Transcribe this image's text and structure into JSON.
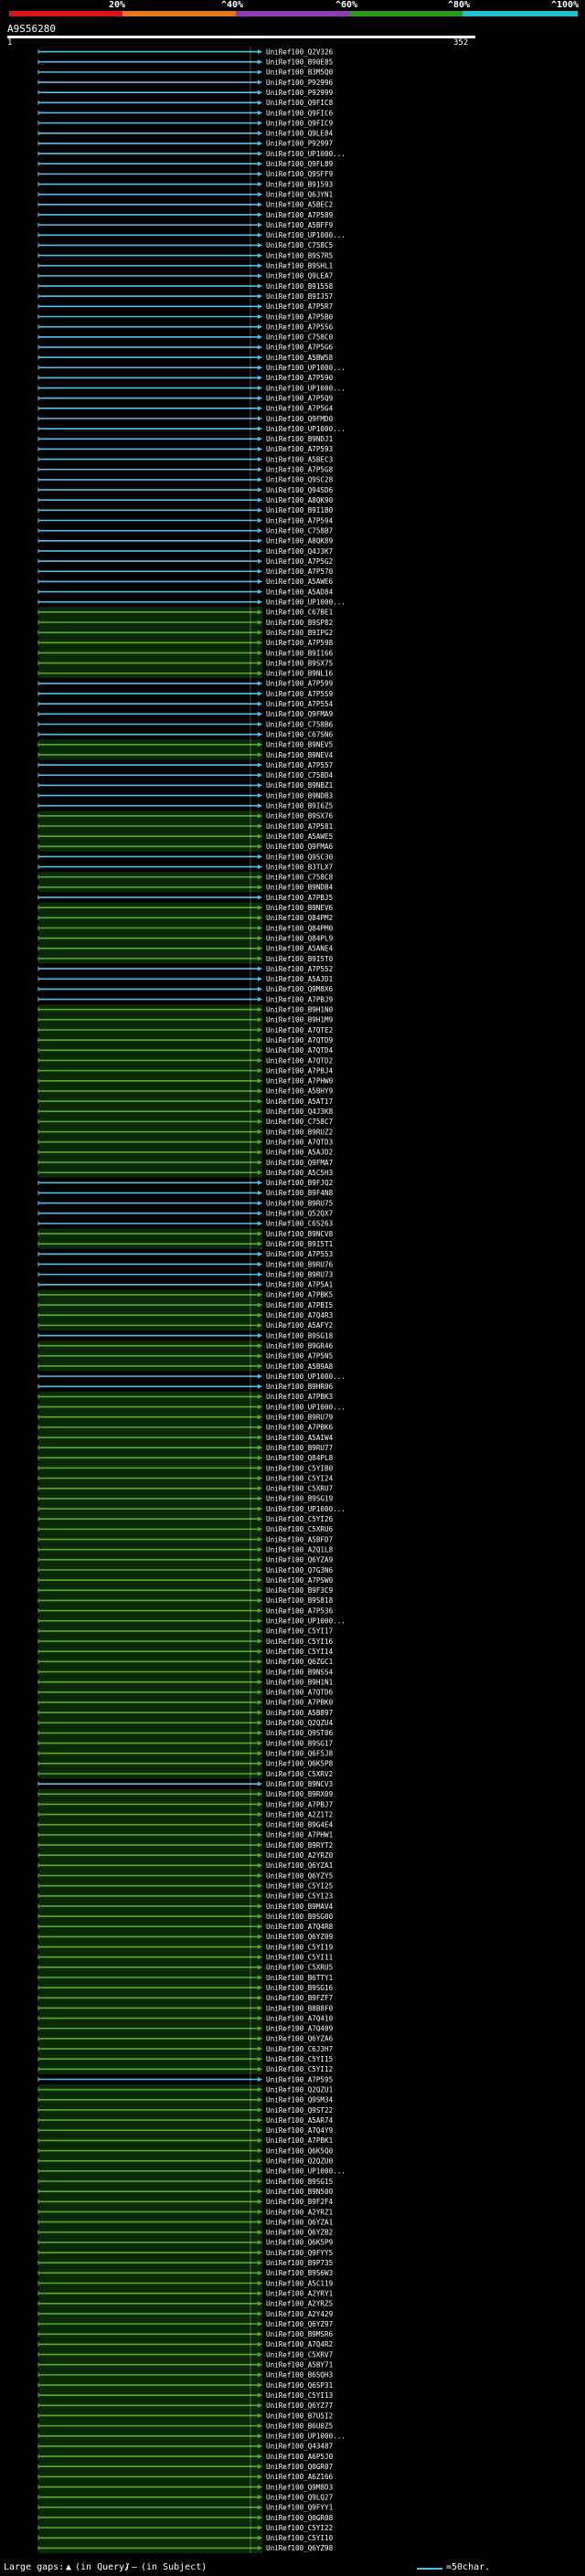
{
  "colors": {
    "cyan": "#4fc1e9",
    "green": "#5ba82a",
    "red": "#d8141c",
    "orange": "#e27a1c",
    "purple": "#8f3ab7",
    "darkgreen": "#2d9a1b",
    "scyan": "#21bfd3"
  },
  "scale": {
    "labels": [
      "20%",
      "^40%",
      "^60%",
      "^80%",
      "^100%"
    ]
  },
  "query": {
    "name": "A9S56280",
    "start": "1",
    "end": "352"
  },
  "hits": [
    {
      "name": "UniRef100_Q2V326",
      "color": "cyan"
    },
    {
      "name": "UniRef100_B90E85",
      "color": "cyan"
    },
    {
      "name": "UniRef100_B3M5Q0",
      "color": "cyan"
    },
    {
      "name": "UniRef100_P92996",
      "color": "cyan"
    },
    {
      "name": "UniRef100_P92999",
      "color": "cyan"
    },
    {
      "name": "UniRef100_Q9FIC8",
      "color": "cyan"
    },
    {
      "name": "UniRef100_Q9FIC6",
      "color": "cyan"
    },
    {
      "name": "UniRef100_Q9FIC9",
      "color": "cyan"
    },
    {
      "name": "UniRef100_Q9LE84",
      "color": "cyan"
    },
    {
      "name": "UniRef100_P92997",
      "color": "cyan"
    },
    {
      "name": "UniRef100_UP1000...",
      "color": "cyan"
    },
    {
      "name": "UniRef100_Q9FL89",
      "color": "cyan"
    },
    {
      "name": "UniRef100_Q9SFF9",
      "color": "cyan"
    },
    {
      "name": "UniRef100_B91593",
      "color": "cyan"
    },
    {
      "name": "UniRef100_Q6JYN1",
      "color": "cyan"
    },
    {
      "name": "UniRef100_A5BEC2",
      "color": "cyan"
    },
    {
      "name": "UniRef100_A7P589",
      "color": "cyan"
    },
    {
      "name": "UniRef100_A5BFF9",
      "color": "cyan"
    },
    {
      "name": "UniRef100_UP1000...",
      "color": "cyan"
    },
    {
      "name": "UniRef100_C758C5",
      "color": "cyan"
    },
    {
      "name": "UniRef100_B9S7R5",
      "color": "cyan"
    },
    {
      "name": "UniRef100_B9SHL1",
      "color": "cyan"
    },
    {
      "name": "UniRef100_Q9LEA7",
      "color": "cyan"
    },
    {
      "name": "UniRef100_B91558",
      "color": "cyan"
    },
    {
      "name": "UniRef100_B9IJ57",
      "color": "cyan"
    },
    {
      "name": "UniRef100_A7P5R7",
      "color": "cyan"
    },
    {
      "name": "UniRef100_A7P5B0",
      "color": "cyan"
    },
    {
      "name": "UniRef100_A7P5S6",
      "color": "cyan"
    },
    {
      "name": "UniRef100_C758C0",
      "color": "cyan"
    },
    {
      "name": "UniRef100_A7P5G6",
      "color": "cyan"
    },
    {
      "name": "UniRef100_A5BW58",
      "color": "cyan"
    },
    {
      "name": "UniRef100_UP1000...",
      "color": "cyan"
    },
    {
      "name": "UniRef100_A7P590",
      "color": "cyan"
    },
    {
      "name": "UniRef100_UP1000...",
      "color": "cyan"
    },
    {
      "name": "UniRef100_A7P5Q9",
      "color": "cyan"
    },
    {
      "name": "UniRef100_A7P5G4",
      "color": "cyan"
    },
    {
      "name": "UniRef100_Q9FMD0",
      "color": "cyan"
    },
    {
      "name": "UniRef100_UP1000...",
      "color": "cyan"
    },
    {
      "name": "UniRef100_B9NDJ1",
      "color": "cyan"
    },
    {
      "name": "UniRef100_A7P593",
      "color": "cyan"
    },
    {
      "name": "UniRef100_A5BEC3",
      "color": "cyan"
    },
    {
      "name": "UniRef100_A7P5G8",
      "color": "cyan"
    },
    {
      "name": "UniRef100_Q9SC28",
      "color": "cyan"
    },
    {
      "name": "UniRef100_Q94SD6",
      "color": "cyan"
    },
    {
      "name": "UniRef100_A8QK90",
      "color": "cyan"
    },
    {
      "name": "UniRef100_B9I1B0",
      "color": "cyan"
    },
    {
      "name": "UniRef100_A7P594",
      "color": "cyan"
    },
    {
      "name": "UniRef100_C758B7",
      "color": "cyan"
    },
    {
      "name": "UniRef100_A8QK89",
      "color": "cyan"
    },
    {
      "name": "UniRef100_Q4J3K7",
      "color": "cyan"
    },
    {
      "name": "UniRef100_A7P5G2",
      "color": "cyan"
    },
    {
      "name": "UniRef100_A7P570",
      "color": "cyan"
    },
    {
      "name": "UniRef100_A5AWE6",
      "color": "cyan"
    },
    {
      "name": "UniRef100_A5AD84",
      "color": "cyan"
    },
    {
      "name": "UniRef100_UP1000...",
      "color": "cyan"
    },
    {
      "name": "UniRef100_C67BE1",
      "color": "green"
    },
    {
      "name": "UniRef100_B9SP82",
      "color": "green"
    },
    {
      "name": "UniRef100_B9IPG2",
      "color": "green"
    },
    {
      "name": "UniRef100_A7P598",
      "color": "green"
    },
    {
      "name": "UniRef100_B9I166",
      "color": "green"
    },
    {
      "name": "UniRef100_B9SX75",
      "color": "green"
    },
    {
      "name": "UniRef100_B9NL16",
      "color": "green"
    },
    {
      "name": "UniRef100_A7P599",
      "color": "cyan"
    },
    {
      "name": "UniRef100_A7P5S9",
      "color": "cyan"
    },
    {
      "name": "UniRef100_A7P554",
      "color": "cyan"
    },
    {
      "name": "UniRef100_Q9FMA9",
      "color": "cyan"
    },
    {
      "name": "UniRef100_C758B6",
      "color": "cyan"
    },
    {
      "name": "UniRef100_C67SN6",
      "color": "cyan"
    },
    {
      "name": "UniRef100_B9NEV5",
      "color": "green"
    },
    {
      "name": "UniRef100_B9NEV4",
      "color": "green"
    },
    {
      "name": "UniRef100_A7P557",
      "color": "cyan"
    },
    {
      "name": "UniRef100_C758D4",
      "color": "cyan"
    },
    {
      "name": "UniRef100_B9NBZ1",
      "color": "cyan"
    },
    {
      "name": "UniRef100_B9NDB3",
      "color": "cyan"
    },
    {
      "name": "UniRef100_B9I6Z5",
      "color": "cyan"
    },
    {
      "name": "UniRef100_B9SX76",
      "color": "green"
    },
    {
      "name": "UniRef100_A7P581",
      "color": "green"
    },
    {
      "name": "UniRef100_A5AWE5",
      "color": "green"
    },
    {
      "name": "UniRef100_Q9FMA6",
      "color": "green"
    },
    {
      "name": "UniRef100_Q9SC30",
      "color": "cyan"
    },
    {
      "name": "UniRef100_B3TLX7",
      "color": "cyan"
    },
    {
      "name": "UniRef100_C758C8",
      "color": "green"
    },
    {
      "name": "UniRef100_B9NDB4",
      "color": "green"
    },
    {
      "name": "UniRef100_A7PBJ5",
      "color": "cyan"
    },
    {
      "name": "UniRef100_B9NEV6",
      "color": "green"
    },
    {
      "name": "UniRef100_Q84PM2",
      "color": "green"
    },
    {
      "name": "UniRef100_Q84PM0",
      "color": "green"
    },
    {
      "name": "UniRef100_Q84PL9",
      "color": "green"
    },
    {
      "name": "UniRef100_A5ANE4",
      "color": "green"
    },
    {
      "name": "UniRef100_B9I5T0",
      "color": "green"
    },
    {
      "name": "UniRef100_A7P552",
      "color": "cyan"
    },
    {
      "name": "UniRef100_A5AJD1",
      "color": "cyan"
    },
    {
      "name": "UniRef100_Q9M8X6",
      "color": "cyan"
    },
    {
      "name": "UniRef100_A7PBJ9",
      "color": "cyan"
    },
    {
      "name": "UniRef100_B9H1N0",
      "color": "green"
    },
    {
      "name": "UniRef100_B9H1M9",
      "color": "green"
    },
    {
      "name": "UniRef100_A7QTE2",
      "color": "green"
    },
    {
      "name": "UniRef100_A7QTD9",
      "color": "green"
    },
    {
      "name": "UniRef100_A7QTD4",
      "color": "green"
    },
    {
      "name": "UniRef100_A7QTD2",
      "color": "green"
    },
    {
      "name": "UniRef100_A7PBJ4",
      "color": "green"
    },
    {
      "name": "UniRef100_A7PHW0",
      "color": "green"
    },
    {
      "name": "UniRef100_A5BHY9",
      "color": "green"
    },
    {
      "name": "UniRef100_A5AT17",
      "color": "green"
    },
    {
      "name": "UniRef100_Q4J3K8",
      "color": "green"
    },
    {
      "name": "UniRef100_C758C7",
      "color": "green"
    },
    {
      "name": "UniRef100_B9RUZ2",
      "color": "green"
    },
    {
      "name": "UniRef100_A7QTD3",
      "color": "green"
    },
    {
      "name": "UniRef100_A5AJD2",
      "color": "green"
    },
    {
      "name": "UniRef100_Q9FMA7",
      "color": "green"
    },
    {
      "name": "UniRef100_A5C5H3",
      "color": "green"
    },
    {
      "name": "UniRef100_B9FJQ2",
      "color": "cyan"
    },
    {
      "name": "UniRef100_B9F4N8",
      "color": "cyan"
    },
    {
      "name": "UniRef100_B9RU75",
      "color": "cyan"
    },
    {
      "name": "UniRef100_Q52QX7",
      "color": "cyan"
    },
    {
      "name": "UniRef100_C6S263",
      "color": "cyan"
    },
    {
      "name": "UniRef100_B9NCV8",
      "color": "green"
    },
    {
      "name": "UniRef100_B9I5T1",
      "color": "green"
    },
    {
      "name": "UniRef100_A7P553",
      "color": "cyan"
    },
    {
      "name": "UniRef100_B9RU76",
      "color": "cyan"
    },
    {
      "name": "UniRef100_B9RU73",
      "color": "cyan"
    },
    {
      "name": "UniRef100_A7P5A1",
      "color": "cyan"
    },
    {
      "name": "UniRef100_A7PBK5",
      "color": "green"
    },
    {
      "name": "UniRef100_A7PBI5",
      "color": "green"
    },
    {
      "name": "UniRef100_A7Q4R3",
      "color": "green"
    },
    {
      "name": "UniRef100_A5AFY2",
      "color": "green"
    },
    {
      "name": "UniRef100_B9SG18",
      "color": "cyan"
    },
    {
      "name": "UniRef100_B9GR46",
      "color": "green"
    },
    {
      "name": "UniRef100_A7P5N5",
      "color": "green"
    },
    {
      "name": "UniRef100_A5B9A8",
      "color": "green"
    },
    {
      "name": "UniRef100_UP1000...",
      "color": "cyan"
    },
    {
      "name": "UniRef100_B9HR06",
      "color": "cyan"
    },
    {
      "name": "UniRef100_A7PBK3",
      "color": "green"
    },
    {
      "name": "UniRef100_UP1000...",
      "color": "green"
    },
    {
      "name": "UniRef100_B9RU79",
      "color": "green"
    },
    {
      "name": "UniRef100_A7PBK6",
      "color": "green"
    },
    {
      "name": "UniRef100_A5AIW4",
      "color": "green"
    },
    {
      "name": "UniRef100_B9RU77",
      "color": "green"
    },
    {
      "name": "UniRef100_Q84PL8",
      "color": "green"
    },
    {
      "name": "UniRef100_C5YIB0",
      "color": "green"
    },
    {
      "name": "UniRef100_C5YI24",
      "color": "green"
    },
    {
      "name": "UniRef100_C5XRU7",
      "color": "green"
    },
    {
      "name": "UniRef100_B9SG19",
      "color": "green"
    },
    {
      "name": "UniRef100_UP1000...",
      "color": "green"
    },
    {
      "name": "UniRef100_C5YI26",
      "color": "green"
    },
    {
      "name": "UniRef100_C5XRU6",
      "color": "green"
    },
    {
      "name": "UniRef100_A5BFD7",
      "color": "green"
    },
    {
      "name": "UniRef100_A2Q1L8",
      "color": "green"
    },
    {
      "name": "UniRef100_Q6YZA9",
      "color": "green"
    },
    {
      "name": "UniRef100_Q7G3N6",
      "color": "green"
    },
    {
      "name": "UniRef100_A7PSW0",
      "color": "green"
    },
    {
      "name": "UniRef100_B9F3C9",
      "color": "green"
    },
    {
      "name": "UniRef100_B9S818",
      "color": "green"
    },
    {
      "name": "UniRef100_A7P536",
      "color": "green"
    },
    {
      "name": "UniRef100_UP1000...",
      "color": "green"
    },
    {
      "name": "UniRef100_C5YI17",
      "color": "green"
    },
    {
      "name": "UniRef100_C5YI16",
      "color": "green"
    },
    {
      "name": "UniRef100_C5YI14",
      "color": "green"
    },
    {
      "name": "UniRef100_Q6ZGC1",
      "color": "green"
    },
    {
      "name": "UniRef100_B9NSS4",
      "color": "green"
    },
    {
      "name": "UniRef100_B9H1N1",
      "color": "green"
    },
    {
      "name": "UniRef100_A7QTD6",
      "color": "green"
    },
    {
      "name": "UniRef100_A7PBK0",
      "color": "green"
    },
    {
      "name": "UniRef100_A5B897",
      "color": "green"
    },
    {
      "name": "UniRef100_Q2QZU4",
      "color": "green"
    },
    {
      "name": "UniRef100_Q9ST06",
      "color": "green"
    },
    {
      "name": "UniRef100_B9SG17",
      "color": "green"
    },
    {
      "name": "UniRef100_Q6F5J8",
      "color": "green"
    },
    {
      "name": "UniRef100_Q6K5P8",
      "color": "green"
    },
    {
      "name": "UniRef100_C5XRV2",
      "color": "green"
    },
    {
      "name": "UniRef100_B9NCV3",
      "color": "cyan"
    },
    {
      "name": "UniRef100_B9RX09",
      "color": "green"
    },
    {
      "name": "UniRef100_A7PBJ7",
      "color": "green"
    },
    {
      "name": "UniRef100_A2Z1T2",
      "color": "green"
    },
    {
      "name": "UniRef100_B9G4E4",
      "color": "green"
    },
    {
      "name": "UniRef100_A7PHW1",
      "color": "green"
    },
    {
      "name": "UniRef100_B9RYT2",
      "color": "green"
    },
    {
      "name": "UniRef100_A2YRZ0",
      "color": "green"
    },
    {
      "name": "UniRef100_Q6YZA1",
      "color": "green"
    },
    {
      "name": "UniRef100_Q6YZY5",
      "color": "green"
    },
    {
      "name": "UniRef100_C5YI25",
      "color": "green"
    },
    {
      "name": "UniRef100_C5YI23",
      "color": "green"
    },
    {
      "name": "UniRef100_B9MAV4",
      "color": "green"
    },
    {
      "name": "UniRef100_B9SG00",
      "color": "green"
    },
    {
      "name": "UniRef100_A7Q4R8",
      "color": "green"
    },
    {
      "name": "UniRef100_Q6YZ09",
      "color": "green"
    },
    {
      "name": "UniRef100_C5YI19",
      "color": "green"
    },
    {
      "name": "UniRef100_C5YI11",
      "color": "green"
    },
    {
      "name": "UniRef100_C5XRU5",
      "color": "green"
    },
    {
      "name": "UniRef100_B6TTY1",
      "color": "green"
    },
    {
      "name": "UniRef100_B9SG16",
      "color": "green"
    },
    {
      "name": "UniRef100_B9FZF7",
      "color": "green"
    },
    {
      "name": "UniRef100_B8B8F0",
      "color": "green"
    },
    {
      "name": "UniRef100_A7Q410",
      "color": "green"
    },
    {
      "name": "UniRef100_A7Q409",
      "color": "green"
    },
    {
      "name": "UniRef100_Q6YZA6",
      "color": "green"
    },
    {
      "name": "UniRef100_C6J3H7",
      "color": "green"
    },
    {
      "name": "UniRef100_C5YI15",
      "color": "green"
    },
    {
      "name": "UniRef100_C5YI12",
      "color": "green"
    },
    {
      "name": "UniRef100_A7P595",
      "color": "cyan"
    },
    {
      "name": "UniRef100_Q2QZU1",
      "color": "green"
    },
    {
      "name": "UniRef100_Q9SM34",
      "color": "green"
    },
    {
      "name": "UniRef100_Q9ST22",
      "color": "green"
    },
    {
      "name": "UniRef100_A5AR74",
      "color": "green"
    },
    {
      "name": "UniRef100_A7Q4Y9",
      "color": "green"
    },
    {
      "name": "UniRef100_A7PBK1",
      "color": "green"
    },
    {
      "name": "UniRef100_Q6K5Q0",
      "color": "green"
    },
    {
      "name": "UniRef100_Q2QZU0",
      "color": "green"
    },
    {
      "name": "UniRef100_UP1000...",
      "color": "green"
    },
    {
      "name": "UniRef100_B9SG15",
      "color": "green"
    },
    {
      "name": "UniRef100_B9N500",
      "color": "green"
    },
    {
      "name": "UniRef100_B9F2F4",
      "color": "green"
    },
    {
      "name": "UniRef100_A2YRZ1",
      "color": "green"
    },
    {
      "name": "UniRef100_Q6YZA1",
      "color": "green"
    },
    {
      "name": "UniRef100_Q6YZB2",
      "color": "green"
    },
    {
      "name": "UniRef100_Q6K5P9",
      "color": "green"
    },
    {
      "name": "UniRef100_Q9FYY5",
      "color": "green"
    },
    {
      "name": "UniRef100_B9P735",
      "color": "green"
    },
    {
      "name": "UniRef100_B9S6W3",
      "color": "green"
    },
    {
      "name": "UniRef100_A5C119",
      "color": "green"
    },
    {
      "name": "UniRef100_A2YRY1",
      "color": "green"
    },
    {
      "name": "UniRef100_A2YRZ5",
      "color": "green"
    },
    {
      "name": "UniRef100_A2Y429",
      "color": "green"
    },
    {
      "name": "UniRef100_Q6YZ97",
      "color": "green"
    },
    {
      "name": "UniRef100_B9MSR6",
      "color": "green"
    },
    {
      "name": "UniRef100_A7Q4R2",
      "color": "green"
    },
    {
      "name": "UniRef100_C5XRV7",
      "color": "green"
    },
    {
      "name": "UniRef100_A5BY71",
      "color": "green"
    },
    {
      "name": "UniRef100_B6SQH3",
      "color": "green"
    },
    {
      "name": "UniRef100_Q6SP31",
      "color": "green"
    },
    {
      "name": "UniRef100_C5YI13",
      "color": "green"
    },
    {
      "name": "UniRef100_Q6YZ77",
      "color": "green"
    },
    {
      "name": "UniRef100_B7U5I2",
      "color": "green"
    },
    {
      "name": "UniRef100_B6U0Z5",
      "color": "green"
    },
    {
      "name": "UniRef100_UP1000...",
      "color": "green"
    },
    {
      "name": "UniRef100_Q43487",
      "color": "green"
    },
    {
      "name": "UniRef100_A6P5J0",
      "color": "green"
    },
    {
      "name": "UniRef100_Q0GR07",
      "color": "green"
    },
    {
      "name": "UniRef100_A6Z166",
      "color": "green"
    },
    {
      "name": "UniRef100_Q9M8D3",
      "color": "green"
    },
    {
      "name": "UniRef100_Q9LQ27",
      "color": "green"
    },
    {
      "name": "UniRef100_Q9FYY1",
      "color": "green"
    },
    {
      "name": "UniRef100_Q0GR08",
      "color": "green"
    },
    {
      "name": "UniRef100_C5YI22",
      "color": "green"
    },
    {
      "name": "UniRef100_C5YI10",
      "color": "green"
    },
    {
      "name": "UniRef100_Q6YZ98",
      "color": "green"
    }
  ],
  "footer": {
    "large_gaps": "Large gaps:",
    "in_query": "(in Query)",
    "slash": "/",
    "in_subject": "(in Subject)",
    "scale_text": "=50char."
  }
}
